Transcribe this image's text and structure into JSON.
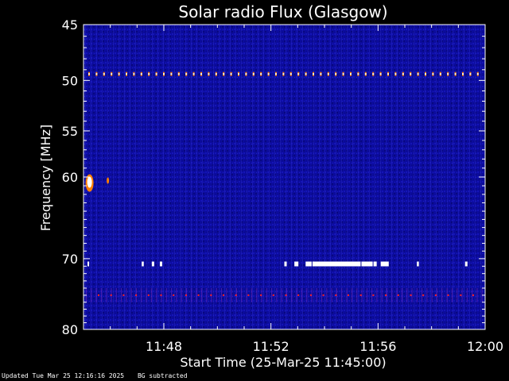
{
  "chart_data": {
    "type": "heatmap",
    "title": "Solar radio Flux (Glasgow)",
    "xlabel": "Start Time (25-Mar-25 11:45:00)",
    "ylabel": "Frequency [MHz]",
    "x_range": [
      "11:45:00",
      "12:00:00"
    ],
    "y_range": [
      45,
      80
    ],
    "y_scale": "log",
    "y_ticks": [
      45,
      50,
      55,
      60,
      70,
      80
    ],
    "x_ticks": [
      "11:48",
      "11:52",
      "11:56",
      "12:00"
    ],
    "grid": false,
    "features": [
      {
        "label": "persistent interference line",
        "frequency_mhz": 49.4
      },
      {
        "label": "interference band",
        "frequency_mhz": 70.7,
        "time_range": [
          "11:45",
          "11:59"
        ]
      },
      {
        "label": "weak band",
        "frequency_mhz_range": [
          74,
          76
        ]
      },
      {
        "label": "bright spot",
        "frequency_mhz": 60.5,
        "time": "11:45:10"
      }
    ],
    "colors": {
      "background": "#000000",
      "spectrogram_base": "#0a0aa0",
      "hot": "#ffffff",
      "warm": "#ff8000"
    }
  },
  "footer": {
    "updated": "Updated Tue Mar 25 12:16:16 2025",
    "note": "BG subtracted"
  }
}
